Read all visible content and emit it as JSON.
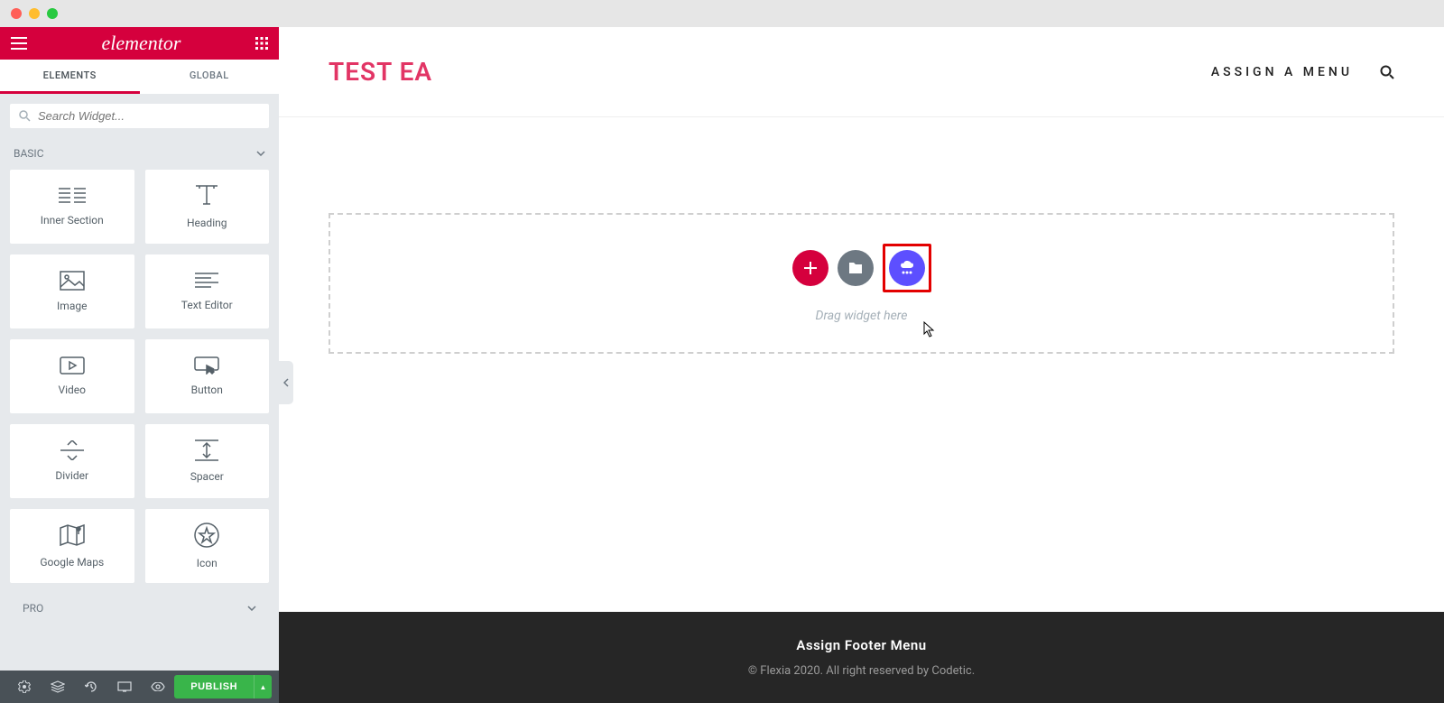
{
  "brand": "elementor",
  "tabs": {
    "elements": "ELEMENTS",
    "global": "GLOBAL"
  },
  "search": {
    "placeholder": "Search Widget..."
  },
  "categories": {
    "basic": "BASIC",
    "pro": "PRO"
  },
  "widgets": {
    "inner_section": "Inner Section",
    "heading": "Heading",
    "image": "Image",
    "text_editor": "Text Editor",
    "video": "Video",
    "button": "Button",
    "divider": "Divider",
    "spacer": "Spacer",
    "google_maps": "Google Maps",
    "icon": "Icon"
  },
  "footer": {
    "publish": "PUBLISH"
  },
  "preview": {
    "site_title": "TEST EA",
    "assign_menu": "ASSIGN A MENU",
    "drop_text": "Drag widget here",
    "footer_title": "Assign Footer Menu",
    "footer_copy": "© Flexia 2020. All right reserved by Codetic."
  }
}
